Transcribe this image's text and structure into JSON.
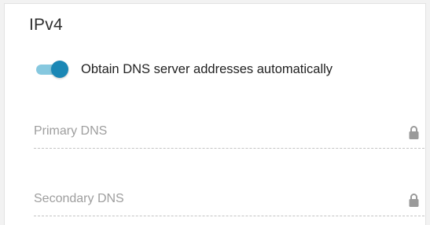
{
  "section": {
    "title": "IPv4"
  },
  "dns_toggle": {
    "label": "Obtain DNS server addresses automatically",
    "enabled": true
  },
  "fields": {
    "primary_dns": {
      "placeholder": "Primary DNS",
      "value": "",
      "locked": true,
      "icon": "lock-icon"
    },
    "secondary_dns": {
      "placeholder": "Secondary DNS",
      "value": "",
      "locked": true,
      "icon": "lock-icon"
    }
  },
  "colors": {
    "toggle_thumb": "#1b87b5",
    "toggle_track": "#86c8df",
    "placeholder": "#9e9e9e",
    "lock": "#9a9a9a"
  }
}
